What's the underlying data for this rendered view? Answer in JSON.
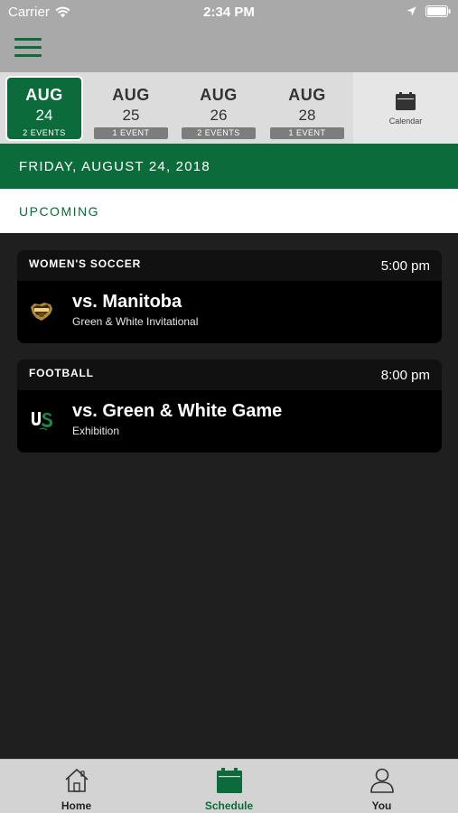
{
  "status_bar": {
    "carrier": "Carrier",
    "time": "2:34 PM"
  },
  "date_strip": {
    "items": [
      {
        "month": "AUG",
        "day": "24",
        "events": "2 EVENTS",
        "selected": true
      },
      {
        "month": "AUG",
        "day": "25",
        "events": "1 EVENT",
        "selected": false
      },
      {
        "month": "AUG",
        "day": "26",
        "events": "2 EVENTS",
        "selected": false
      },
      {
        "month": "AUG",
        "day": "28",
        "events": "1 EVENT",
        "selected": false
      }
    ],
    "calendar_label": "Calendar"
  },
  "date_header": "FRIDAY, AUGUST 24, 2018",
  "section_label": "UPCOMING",
  "events": [
    {
      "sport": "WOMEN'S SOCCER",
      "time": "5:00 pm",
      "opponent": "vs. Manitoba",
      "detail": "Green & White Invitational",
      "logo": "bisons-logo"
    },
    {
      "sport": "FOOTBALL",
      "time": "8:00 pm",
      "opponent": "vs. Green & White Game",
      "detail": "Exhibition",
      "logo": "usask-logo"
    }
  ],
  "tab_bar": {
    "tabs": [
      {
        "label": "Home",
        "icon": "home-icon",
        "active": false
      },
      {
        "label": "Schedule",
        "icon": "calendar-icon",
        "active": true
      },
      {
        "label": "You",
        "icon": "person-icon",
        "active": false
      }
    ]
  },
  "colors": {
    "brand_green": "#0b6b3a",
    "chrome_gray": "#a9a9a9",
    "background": "#1f1f1f"
  }
}
